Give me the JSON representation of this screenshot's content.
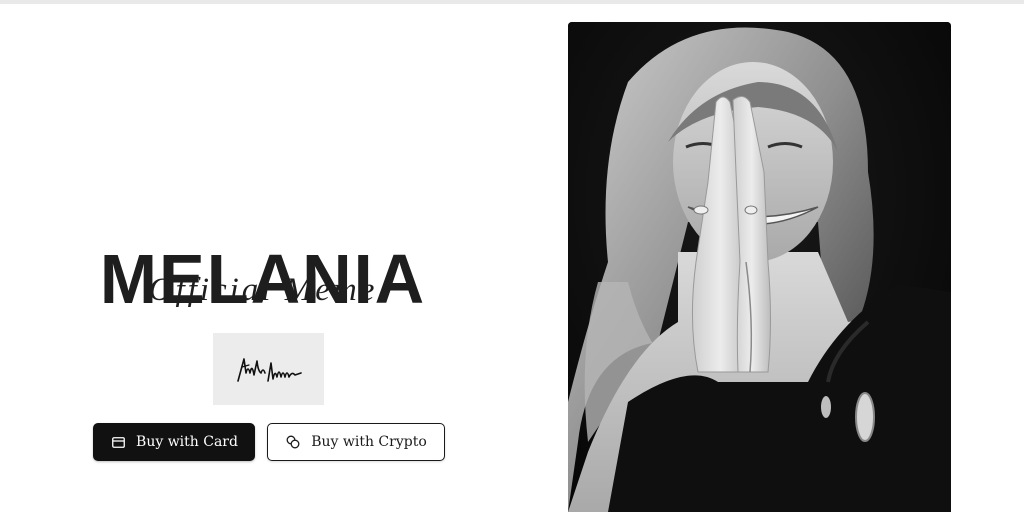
{
  "hero": {
    "title": "MELANIA",
    "subtitle": "Official Meme"
  },
  "signature": {
    "icon": "signature-icon"
  },
  "buttons": {
    "card": {
      "label": "Buy with Card",
      "icon": "credit-card-icon"
    },
    "crypto": {
      "label": "Buy with Crypto",
      "icon": "coins-icon"
    }
  },
  "photo": {
    "subject": "portrait-image"
  },
  "colors": {
    "primary_button_bg": "#111111",
    "primary_button_text": "#ffffff",
    "secondary_button_border": "#1a1a1a",
    "title_text": "#1e1e1e",
    "signature_bg": "#ececec"
  }
}
